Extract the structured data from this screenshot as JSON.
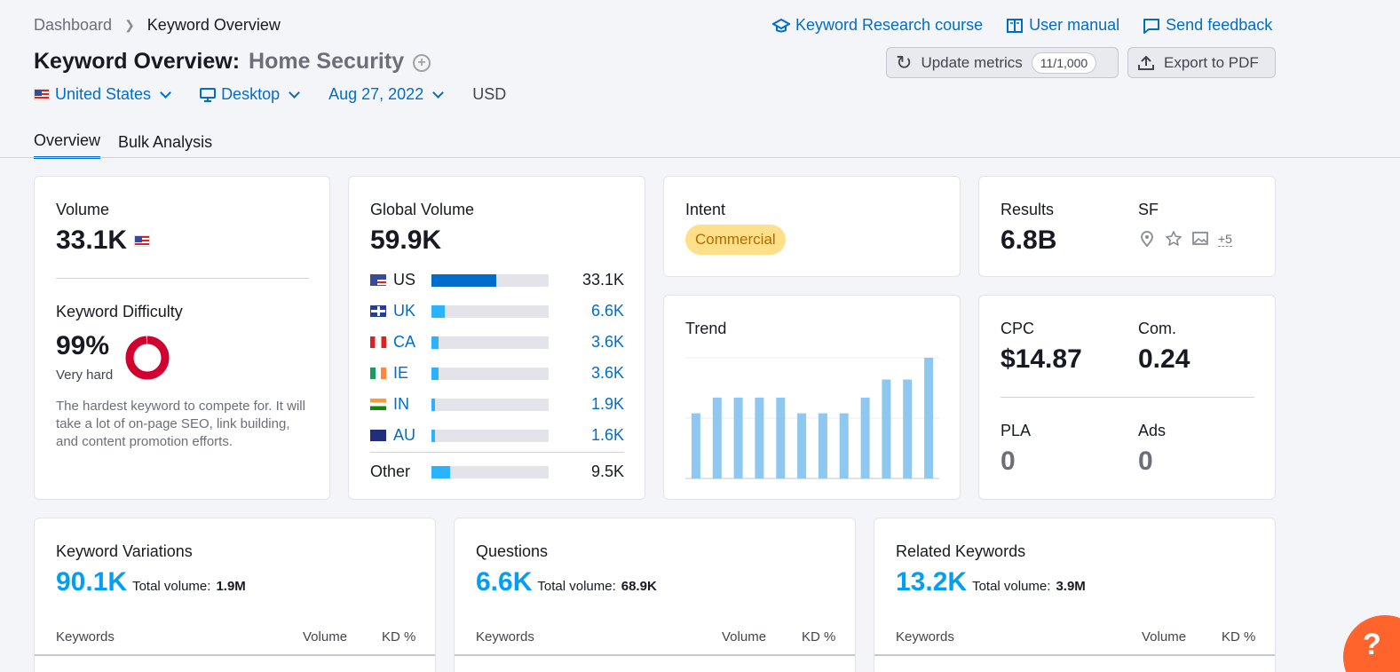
{
  "breadcrumb": {
    "root": "Dashboard",
    "current": "Keyword Overview"
  },
  "top_links": [
    {
      "label": "Keyword Research course",
      "icon": "graduation-cap-icon"
    },
    {
      "label": "User manual",
      "icon": "book-icon"
    },
    {
      "label": "Send feedback",
      "icon": "feedback-icon"
    }
  ],
  "title": {
    "prefix": "Keyword Overview:",
    "keyword": "Home Security"
  },
  "buttons": {
    "update": "Update metrics",
    "update_count": "11/1,000",
    "export": "Export to PDF"
  },
  "filters": {
    "country": "United States",
    "device": "Desktop",
    "date": "Aug 27, 2022",
    "currency": "USD"
  },
  "tabs": [
    "Overview",
    "Bulk Analysis"
  ],
  "volume": {
    "label": "Volume",
    "value": "33.1K",
    "kd_label": "Keyword Difficulty",
    "kd_value": "99%",
    "kd_level": "Very hard",
    "kd_percent": 99,
    "kd_desc": "The hardest keyword to compete for. It will take a lot of on-page SEO, link building, and content promotion efforts."
  },
  "global_volume": {
    "label": "Global Volume",
    "value": "59.9K",
    "rows": [
      {
        "code": "US",
        "value": "33.1K",
        "share": 0.55,
        "link": false
      },
      {
        "code": "UK",
        "value": "6.6K",
        "share": 0.11,
        "link": true
      },
      {
        "code": "CA",
        "value": "3.6K",
        "share": 0.06,
        "link": true
      },
      {
        "code": "IE",
        "value": "3.6K",
        "share": 0.06,
        "link": true
      },
      {
        "code": "IN",
        "value": "1.9K",
        "share": 0.03,
        "link": true
      },
      {
        "code": "AU",
        "value": "1.6K",
        "share": 0.03,
        "link": true
      }
    ],
    "other": {
      "label": "Other",
      "value": "9.5K",
      "share": 0.16
    }
  },
  "intent": {
    "label": "Intent",
    "value": "Commercial"
  },
  "trend": {
    "label": "Trend",
    "values": [
      0.54,
      0.67,
      0.67,
      0.67,
      0.67,
      0.54,
      0.54,
      0.54,
      0.67,
      0.82,
      0.82,
      1.0
    ]
  },
  "results": {
    "label": "Results",
    "value": "6.8B",
    "sf_label": "SF",
    "sf_more": "+5"
  },
  "cpc": {
    "cpc_label": "CPC",
    "cpc_value": "$14.87",
    "com_label": "Com.",
    "com_value": "0.24",
    "pla_label": "PLA",
    "pla_value": "0",
    "ads_label": "Ads",
    "ads_value": "0"
  },
  "bottom_cards": [
    {
      "title": "Keyword Variations",
      "count": "90.1K",
      "total_label": "Total volume:",
      "total": "1.9M"
    },
    {
      "title": "Questions",
      "count": "6.6K",
      "total_label": "Total volume:",
      "total": "68.9K"
    },
    {
      "title": "Related Keywords",
      "count": "13.2K",
      "total_label": "Total volume:",
      "total": "3.9M"
    }
  ],
  "table_headers": {
    "keywords": "Keywords",
    "volume": "Volume",
    "kd": "KD %"
  },
  "help": {
    "label": "?"
  },
  "colors": {
    "accent": "#006dca",
    "kd_red": "#d1002f",
    "bar_us": "#006dca",
    "bar_other": "#2bb3ff",
    "trend_bar": "#8ec8f0",
    "intent_bg": "#ffe08a"
  }
}
